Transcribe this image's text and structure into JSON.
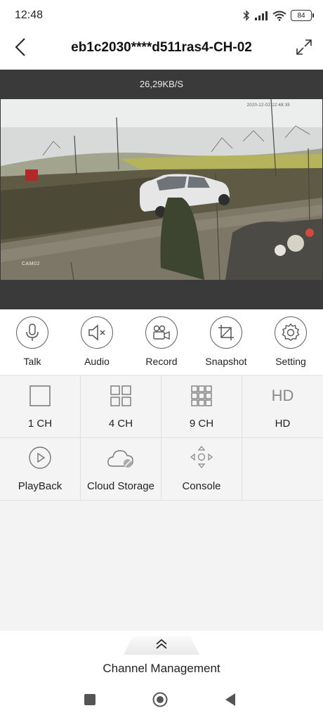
{
  "status_bar": {
    "time": "12:48",
    "battery": "84",
    "icons": [
      "bluetooth-icon",
      "signal-icon",
      "wifi-icon",
      "battery-icon"
    ]
  },
  "header": {
    "title": "eb1c2030****d511ras4-CH-02",
    "back_icon": "back-arrow-icon",
    "fullscreen_icon": "fullscreen-icon"
  },
  "video": {
    "bitrate": "26,29KB/S",
    "camera_label": "CAM02",
    "timestamp": "2020-12-02 12:48:35"
  },
  "actions": [
    {
      "label": "Talk",
      "icon": "microphone-icon"
    },
    {
      "label": "Audio",
      "icon": "speaker-muted-icon"
    },
    {
      "label": "Record",
      "icon": "video-camera-icon"
    },
    {
      "label": "Snapshot",
      "icon": "crop-icon"
    },
    {
      "label": "Setting",
      "icon": "gear-icon"
    }
  ],
  "grid": [
    {
      "label": "1 CH",
      "icon": "single-square-icon"
    },
    {
      "label": "4 CH",
      "icon": "four-grid-icon"
    },
    {
      "label": "9 CH",
      "icon": "nine-grid-icon"
    },
    {
      "label": "HD",
      "icon_text": "HD"
    },
    {
      "label": "PlayBack",
      "icon": "play-circle-icon"
    },
    {
      "label": "Cloud Storage",
      "icon": "cloud-icon"
    },
    {
      "label": "Console",
      "icon": "directional-pad-icon"
    }
  ],
  "bottom": {
    "channel_management": "Channel Management",
    "handle_icon": "double-chevron-up-icon"
  },
  "colors": {
    "video_bg": "#3a3a3a",
    "grid_bg": "#f4f4f4",
    "icon_gray": "#666666"
  }
}
